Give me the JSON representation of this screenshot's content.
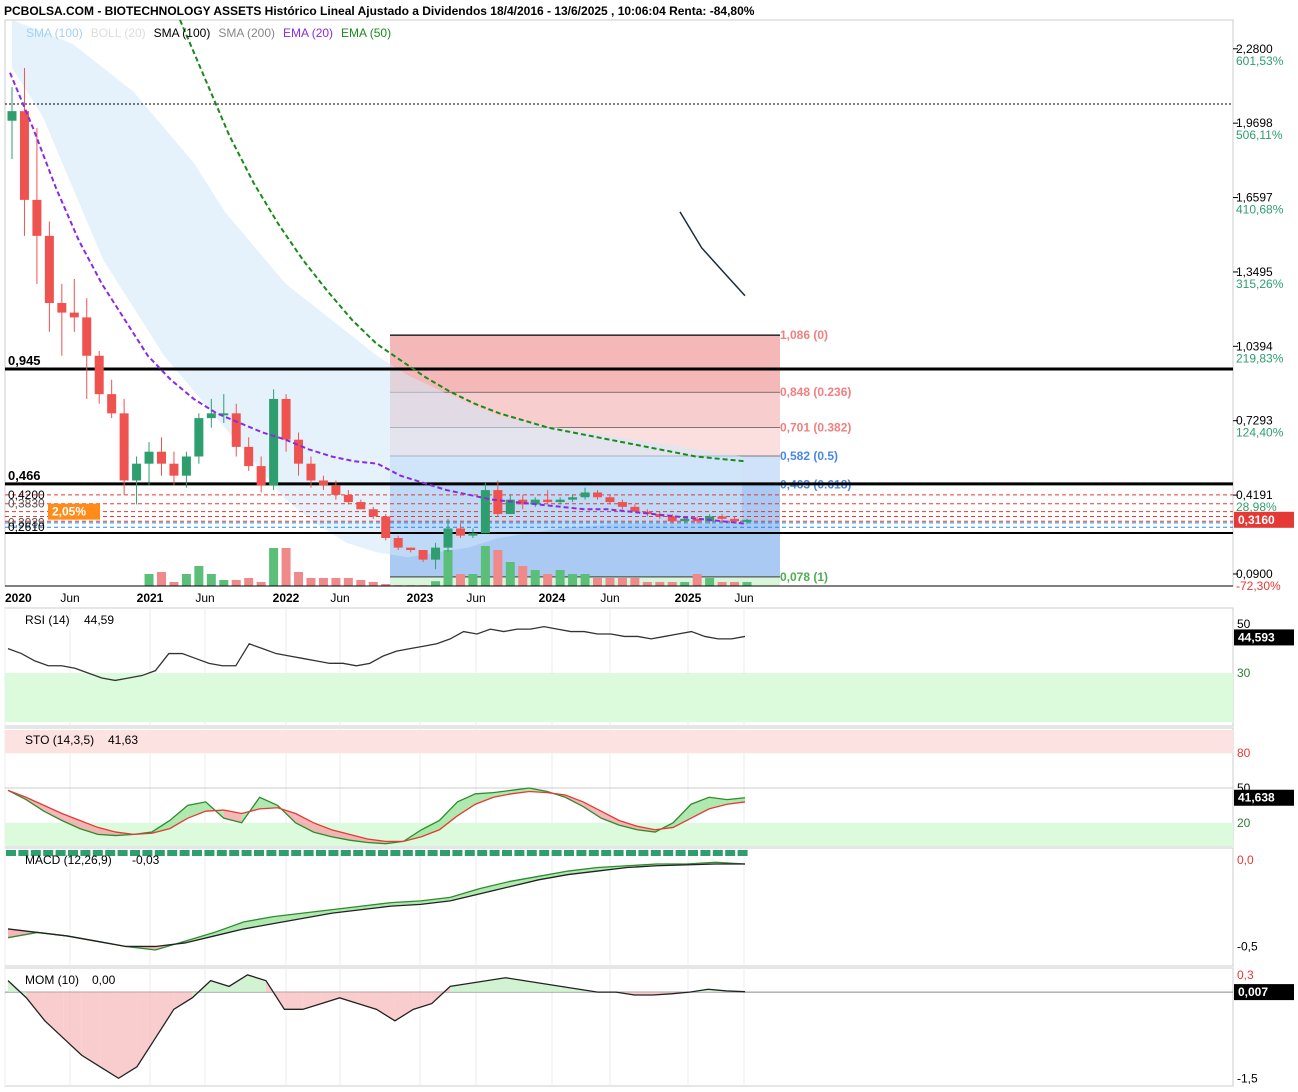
{
  "title": "PCBOLSA.COM - BIOTECHNOLOGY ASSETS Histórico Lineal Ajustado a Dividendos 18/4/2016 - 13/6/2025 , 10:06:04 Renta: -84,80%",
  "legend": [
    {
      "text": "SMA (100)",
      "color": "#9fd3f5"
    },
    {
      "text": "BOLL (20)",
      "color": "#dddddd"
    },
    {
      "text": "SMA (100)",
      "color": "#000000"
    },
    {
      "text": "SMA (200)",
      "color": "#888888"
    },
    {
      "text": "EMA (20)",
      "color": "#8a2be2"
    },
    {
      "text": "EMA (50)",
      "color": "#1a8a1a"
    }
  ],
  "price_axis": [
    {
      "price": "2,2800",
      "pct": "601,53%"
    },
    {
      "price": "1,9698",
      "pct": "506,11%"
    },
    {
      "price": "1,6597",
      "pct": "410,68%"
    },
    {
      "price": "1,3495",
      "pct": "315,26%"
    },
    {
      "price": "1,0394",
      "pct": "219,83%"
    },
    {
      "price": "0,7293",
      "pct": "124,40%"
    },
    {
      "price": "0,4191",
      "pct": "28,98%"
    },
    {
      "price": "0,0900",
      "pct": "-72,30%"
    }
  ],
  "current_price": "0,3160",
  "left_labels": {
    "level_945": "0,945",
    "level_466": "0,466",
    "level_4200": "0,4200",
    "level_3830": "0,3830",
    "level_3039": "0,3039",
    "level_2610": "0,2610",
    "badge": "2,05%"
  },
  "fib_levels": [
    {
      "label": "1,086 (0)",
      "color": "#f08080"
    },
    {
      "label": "0,848 (0.236)",
      "color": "#f08080"
    },
    {
      "label": "0,701 (0.382)",
      "color": "#f08080"
    },
    {
      "label": "0,582 (0.5)",
      "color": "#4a86e8"
    },
    {
      "label": "0,463 (0.618)",
      "color": "#4a86e8"
    },
    {
      "label": "0,078 (1)",
      "color": "#4caf50"
    }
  ],
  "x_axis_labels": [
    "2020",
    "Jun",
    "2021",
    "Jun",
    "2022",
    "Jun",
    "2023",
    "Jun",
    "2024",
    "Jun",
    "2025",
    "Jun"
  ],
  "chart_data": [
    {
      "type": "candlestick",
      "title": "PCBOLSA.COM - BIOTECHNOLOGY ASSETS Histórico Lineal Ajustado a Dividendos 18/4/2016 - 13/6/2025 , 10:06:04 Renta: -84,80%",
      "ylim": [
        0.04,
        2.4
      ],
      "candles": [
        [
          1.98,
          2.12,
          1.82,
          2.02
        ],
        [
          2.02,
          2.2,
          1.5,
          1.65
        ],
        [
          1.65,
          1.95,
          1.3,
          1.5
        ],
        [
          1.5,
          1.56,
          1.1,
          1.22
        ],
        [
          1.22,
          1.3,
          1.0,
          1.18
        ],
        [
          1.18,
          1.32,
          1.1,
          1.16
        ],
        [
          1.16,
          1.24,
          0.82,
          1.0
        ],
        [
          1.0,
          1.02,
          0.8,
          0.84
        ],
        [
          0.84,
          0.9,
          0.74,
          0.76
        ],
        [
          0.76,
          0.82,
          0.42,
          0.48
        ],
        [
          0.48,
          0.58,
          0.38,
          0.55
        ],
        [
          0.55,
          0.64,
          0.46,
          0.6
        ],
        [
          0.6,
          0.66,
          0.5,
          0.55
        ],
        [
          0.55,
          0.6,
          0.46,
          0.5
        ],
        [
          0.5,
          0.6,
          0.45,
          0.58
        ],
        [
          0.58,
          0.76,
          0.55,
          0.74
        ],
        [
          0.74,
          0.82,
          0.7,
          0.76
        ],
        [
          0.76,
          0.84,
          0.72,
          0.76
        ],
        [
          0.76,
          0.8,
          0.58,
          0.62
        ],
        [
          0.62,
          0.66,
          0.52,
          0.54
        ],
        [
          0.54,
          0.58,
          0.43,
          0.46
        ],
        [
          0.46,
          0.86,
          0.44,
          0.82
        ],
        [
          0.82,
          0.84,
          0.6,
          0.65
        ],
        [
          0.65,
          0.68,
          0.5,
          0.55
        ],
        [
          0.55,
          0.58,
          0.45,
          0.48
        ],
        [
          0.48,
          0.5,
          0.44,
          0.46
        ],
        [
          0.46,
          0.48,
          0.4,
          0.42
        ],
        [
          0.42,
          0.44,
          0.38,
          0.39
        ],
        [
          0.39,
          0.4,
          0.36,
          0.36
        ],
        [
          0.36,
          0.37,
          0.32,
          0.33
        ],
        [
          0.33,
          0.34,
          0.23,
          0.24
        ],
        [
          0.24,
          0.25,
          0.19,
          0.2
        ],
        [
          0.2,
          0.2,
          0.18,
          0.19
        ],
        [
          0.19,
          0.19,
          0.14,
          0.15
        ],
        [
          0.15,
          0.22,
          0.11,
          0.2
        ],
        [
          0.2,
          0.32,
          0.18,
          0.28
        ],
        [
          0.28,
          0.3,
          0.24,
          0.25
        ],
        [
          0.25,
          0.28,
          0.24,
          0.26
        ],
        [
          0.26,
          0.47,
          0.26,
          0.44
        ],
        [
          0.44,
          0.48,
          0.33,
          0.34
        ],
        [
          0.34,
          0.42,
          0.34,
          0.4
        ],
        [
          0.4,
          0.42,
          0.36,
          0.38
        ],
        [
          0.38,
          0.41,
          0.37,
          0.4
        ],
        [
          0.4,
          0.44,
          0.38,
          0.39
        ],
        [
          0.39,
          0.41,
          0.38,
          0.4
        ],
        [
          0.4,
          0.42,
          0.39,
          0.41
        ],
        [
          0.41,
          0.45,
          0.4,
          0.43
        ],
        [
          0.43,
          0.44,
          0.4,
          0.41
        ],
        [
          0.41,
          0.42,
          0.38,
          0.39
        ],
        [
          0.39,
          0.4,
          0.36,
          0.37
        ],
        [
          0.37,
          0.38,
          0.35,
          0.35
        ],
        [
          0.35,
          0.36,
          0.33,
          0.34
        ],
        [
          0.34,
          0.35,
          0.32,
          0.33
        ],
        [
          0.33,
          0.34,
          0.3,
          0.31
        ],
        [
          0.31,
          0.33,
          0.3,
          0.32
        ],
        [
          0.32,
          0.33,
          0.3,
          0.31
        ],
        [
          0.31,
          0.34,
          0.3,
          0.33
        ],
        [
          0.33,
          0.34,
          0.31,
          0.32
        ],
        [
          0.32,
          0.33,
          0.3,
          0.31
        ],
        [
          0.31,
          0.32,
          0.3,
          0.316
        ]
      ],
      "volume": [
        0,
        0,
        0,
        0,
        0,
        0,
        0,
        0,
        0,
        0,
        0,
        0.3,
        0.35,
        0.1,
        0.3,
        0.5,
        0.3,
        0.15,
        0.15,
        0.2,
        0.1,
        0.95,
        0.95,
        0.35,
        0.2,
        0.2,
        0.2,
        0.2,
        0.15,
        0.1,
        0.05,
        0.02,
        0.02,
        0.02,
        0.12,
        0.9,
        0.3,
        0.3,
        1.0,
        0.9,
        0.6,
        0.5,
        0.4,
        0.3,
        0.4,
        0.3,
        0.3,
        0.2,
        0.2,
        0.2,
        0.2,
        0.1,
        0.1,
        0.1,
        0.1,
        0.3,
        0.2,
        0.1,
        0.1,
        0.1
      ],
      "ema20": [
        2.18,
        1.95,
        1.7,
        1.48,
        1.3,
        1.15,
        1.0,
        0.9,
        0.82,
        0.76,
        0.72,
        0.68,
        0.65,
        0.61,
        0.58,
        0.56,
        0.55,
        0.5,
        0.47,
        0.44,
        0.42,
        0.4,
        0.39,
        0.38,
        0.37,
        0.36,
        0.36,
        0.35,
        0.34,
        0.33,
        0.32,
        0.31,
        0.3
      ],
      "ema50": [
        2.4,
        2.16,
        1.92,
        1.72,
        1.55,
        1.4,
        1.27,
        1.15,
        1.05,
        0.98,
        0.91,
        0.85,
        0.8,
        0.76,
        0.73,
        0.7,
        0.68,
        0.66,
        0.64,
        0.62,
        0.6,
        0.58,
        0.57,
        0.56
      ]
    },
    {
      "type": "line",
      "title": "RSI (14)",
      "value": "44,59",
      "current": "44,593",
      "ylim": [
        10,
        55
      ],
      "levels": [
        "50",
        "30"
      ],
      "values": [
        40,
        38,
        35,
        33,
        33,
        32,
        30,
        28,
        27,
        28,
        29,
        31,
        38,
        38,
        36,
        34,
        33,
        33,
        42,
        40,
        38,
        37,
        36,
        35,
        34,
        34,
        33,
        34,
        37,
        39,
        40,
        41,
        42,
        44,
        47,
        46,
        48,
        47,
        48,
        48,
        49,
        48,
        47,
        47,
        46,
        46,
        45,
        45,
        44,
        45,
        46,
        47,
        45,
        44,
        44,
        45
      ]
    },
    {
      "type": "line",
      "title": "STO (14,3,5)",
      "value": "41,63",
      "current": "41,638",
      "ylim": [
        0,
        100
      ],
      "levels": [
        "80",
        "50",
        "20"
      ],
      "k": [
        48,
        40,
        30,
        22,
        15,
        10,
        9,
        10,
        12,
        22,
        35,
        38,
        24,
        20,
        42,
        35,
        20,
        12,
        8,
        5,
        3,
        2,
        4,
        14,
        22,
        38,
        45,
        46,
        48,
        50,
        47,
        42,
        34,
        24,
        18,
        14,
        12,
        20,
        36,
        42,
        40,
        41.6
      ],
      "d": [
        48,
        42,
        35,
        28,
        22,
        16,
        12,
        10,
        11,
        15,
        24,
        30,
        31,
        28,
        32,
        33,
        28,
        20,
        14,
        10,
        6,
        4,
        4,
        8,
        14,
        26,
        36,
        42,
        45,
        47,
        46,
        44,
        38,
        30,
        22,
        17,
        14,
        16,
        24,
        32,
        36,
        38
      ]
    },
    {
      "type": "line",
      "title": "MACD (12,26,9)",
      "value": "-0,03",
      "levels": [
        "0,0",
        "-0,5"
      ],
      "ylim": [
        -0.6,
        0.05
      ],
      "macd": [
        -0.45,
        -0.42,
        -0.44,
        -0.47,
        -0.5,
        -0.52,
        -0.47,
        -0.42,
        -0.36,
        -0.33,
        -0.31,
        -0.29,
        -0.27,
        -0.25,
        -0.24,
        -0.22,
        -0.17,
        -0.13,
        -0.1,
        -0.07,
        -0.05,
        -0.04,
        -0.03,
        -0.03,
        -0.02,
        -0.03
      ],
      "signal": [
        -0.4,
        -0.42,
        -0.44,
        -0.47,
        -0.5,
        -0.5,
        -0.48,
        -0.44,
        -0.4,
        -0.37,
        -0.34,
        -0.31,
        -0.29,
        -0.27,
        -0.26,
        -0.24,
        -0.2,
        -0.16,
        -0.12,
        -0.09,
        -0.07,
        -0.05,
        -0.04,
        -0.035,
        -0.03,
        -0.03
      ]
    },
    {
      "type": "line",
      "title": "MOM (10)",
      "value": "0,00",
      "current": "0,007",
      "levels": [
        "0,3",
        "-1,5"
      ],
      "ylim": [
        -1.6,
        0.35
      ],
      "values": [
        0.2,
        -0.1,
        -0.5,
        -0.8,
        -1.1,
        -1.3,
        -1.5,
        -1.3,
        -0.8,
        -0.3,
        -0.1,
        0.2,
        0.1,
        0.3,
        0.2,
        -0.3,
        -0.3,
        -0.2,
        -0.1,
        -0.2,
        -0.3,
        -0.5,
        -0.3,
        -0.2,
        0.1,
        0.15,
        0.2,
        0.25,
        0.2,
        0.15,
        0.1,
        0.05,
        0.0,
        0.0,
        -0.05,
        -0.05,
        -0.03,
        0.0,
        0.05,
        0.02,
        0.007
      ]
    }
  ],
  "colors": {
    "up": "#2e9e6e",
    "down": "#ef5350",
    "fib_red": "#f4a9a9",
    "fib_blue": "#9ec3f2",
    "fib_green": "#c8f2c8"
  }
}
